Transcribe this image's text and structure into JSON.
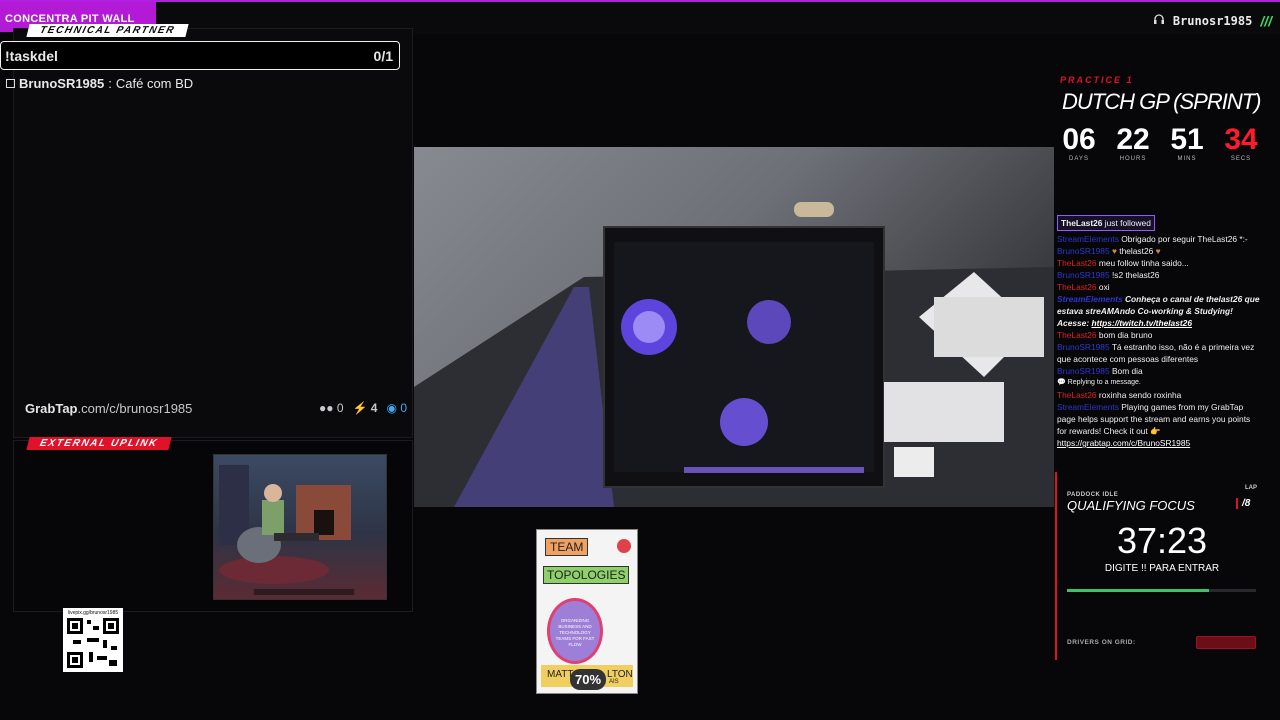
{
  "header": {
    "brand": "CONCENTRA PIT WALL",
    "user": "Brunosr1985",
    "slashes": "///"
  },
  "left_panel": {
    "tag": "TECHNICAL PARTNER",
    "command": "!taskdel",
    "task_count": "0/1",
    "task": {
      "user": "BrunoSR1985",
      "sep": ":",
      "text": "Café com BD",
      "checked": false
    },
    "grabtap": {
      "logo": "GrabTap",
      "url": ".com/c/brunosr1985",
      "stat_users": "0",
      "stat_bolt": "4",
      "stat_points": "0"
    }
  },
  "uplink": {
    "tag": "EXTERNAL UPLINK"
  },
  "qr": {
    "url": "livepix.gg/brunosr1985"
  },
  "book": {
    "title_line1": "TEAM",
    "title_line2": "TOPOLOGIES",
    "subtitle": "ORGANIZING BUSINESS AND TECHNOLOGY TEAMS FOR FAST FLOW",
    "authors_left": "MATT",
    "authors_right": "LTON",
    "authors_small": "AIS",
    "progress": "70%"
  },
  "race": {
    "session": "PRACTICE 1",
    "gp": "DUTCH GP (SPRINT)",
    "countdown": [
      {
        "value": "06",
        "label": "DAYS"
      },
      {
        "value": "22",
        "label": "HOURS"
      },
      {
        "value": "51",
        "label": "MINS"
      },
      {
        "value": "34",
        "label": "SECS"
      }
    ]
  },
  "chat": {
    "follow_name": "TheLast26",
    "follow_text": " just followed",
    "messages": [
      {
        "name": "StreamElements",
        "color": "blue",
        "text": "Obrigado por seguir TheLast26 *:-",
        "italic": false
      },
      {
        "name": "BrunoSR1985",
        "color": "blue",
        "text": "thelast26",
        "italic": false
      },
      {
        "name": "TheLast26",
        "color": "red",
        "text": "meu follow tinha saido...",
        "italic": false
      },
      {
        "name": "BrunoSR1985",
        "color": "blue",
        "text": "!s2 thelast26",
        "italic": false
      },
      {
        "name": "TheLast26",
        "color": "red",
        "text": "oxi",
        "italic": false
      },
      {
        "name": "StreamElements",
        "color": "blue",
        "text": "Conheça o canal de thelast26 que estava streAMAndo Co-working & Studying! Acesse:",
        "italic": true
      },
      {
        "name": "TheLast26",
        "color": "red",
        "text": "bom dia bruno",
        "italic": false
      },
      {
        "name": "BrunoSR1985",
        "color": "blue",
        "text": "Tá estranho isso, não é a primeira vez que acontece com pessoas diferentes",
        "italic": false
      },
      {
        "name": "BrunoSR1985",
        "color": "blue",
        "text": "Bom dia",
        "italic": false
      }
    ],
    "link_twitch": "https://twitch.tv/thelast26",
    "reply_note": "Replying to a message.",
    "after_reply": {
      "name": "TheLast26",
      "text": "roxinha sendo roxinha"
    },
    "grabtap_msg": {
      "name": "StreamElements",
      "text": "Playing games from my GrabTap page helps support the stream and earns you points for rewards! Check it out"
    },
    "grabtap_link": "https://grabtap.com/c/BrunoSR1985"
  },
  "qualifying": {
    "idle": "PADDOCK IDLE",
    "lap_label": "LAP",
    "title": "QUALIFYING FOCUS",
    "position": "/8",
    "timer": "37:23",
    "prompt": "DIGITE !! PARA ENTRAR",
    "progress": 0.75,
    "drivers_label": "DRIVERS ON GRID:"
  },
  "colors": {
    "accent_red": "#e0112b",
    "brand_purple": "#b31ad6",
    "progress_green": "#3cc36a"
  }
}
